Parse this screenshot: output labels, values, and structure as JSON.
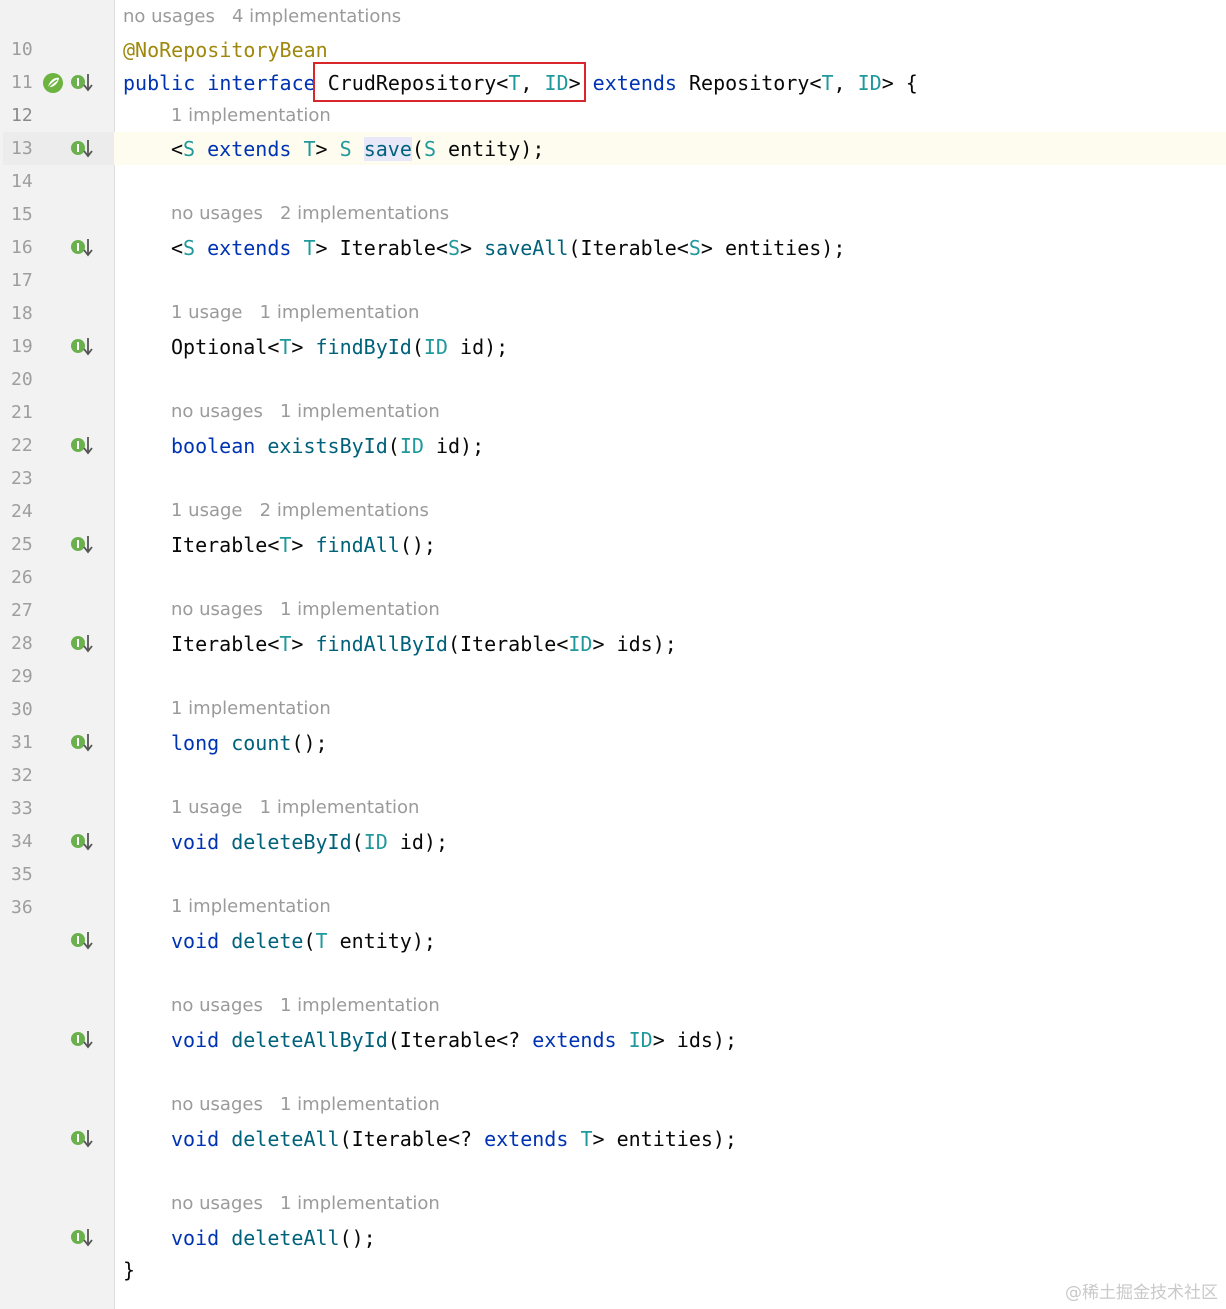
{
  "editor": {
    "class_hint": "no usages   4 implementations",
    "annotation": "@NoRepositoryBean",
    "decl": {
      "public_kw": "public",
      "interface_kw": "interface",
      "name": "CrudRepository",
      "lt": "<",
      "t": "T",
      "comma": ", ",
      "id": "ID",
      "gt": ">",
      "extends_kw": "extends",
      "parent": "Repository",
      "parent_lt": "<",
      "parent_t": "T",
      "parent_comma": ", ",
      "parent_id": "ID",
      "parent_gt": ">",
      "brace": " {"
    },
    "closing_brace": "}",
    "line_numbers": [
      "10",
      "11",
      "12",
      "13",
      "14",
      "15",
      "16",
      "17",
      "18",
      "19",
      "20",
      "21",
      "22",
      "23",
      "24",
      "25",
      "26",
      "27",
      "28",
      "29",
      "30",
      "31",
      "32",
      "33",
      "34",
      "35",
      "36"
    ],
    "hints": [
      "1 implementation",
      "no usages   2 implementations",
      "1 usage   1 implementation",
      "no usages   1 implementation",
      "1 usage   2 implementations",
      "no usages   1 implementation",
      "1 implementation",
      "1 usage   1 implementation",
      "1 implementation",
      "no usages   1 implementation",
      "no usages   1 implementation",
      "no usages   1 implementation"
    ],
    "methods": [
      [
        [
          "p",
          "<"
        ],
        [
          "t",
          "S"
        ],
        [
          "p",
          " "
        ],
        [
          "k",
          "extends"
        ],
        [
          "p",
          " "
        ],
        [
          "t",
          "T"
        ],
        [
          "p",
          "> "
        ],
        [
          "t",
          "S"
        ],
        [
          "p",
          " "
        ],
        [
          "caret",
          ""
        ],
        [
          "fh",
          "save"
        ],
        [
          "p",
          "("
        ],
        [
          "t",
          "S"
        ],
        [
          "p",
          " entity);"
        ]
      ],
      [
        [
          "p",
          "<"
        ],
        [
          "t",
          "S"
        ],
        [
          "p",
          " "
        ],
        [
          "k",
          "extends"
        ],
        [
          "p",
          " "
        ],
        [
          "t",
          "T"
        ],
        [
          "p",
          "> Iterable<"
        ],
        [
          "t",
          "S"
        ],
        [
          "p",
          "> "
        ],
        [
          "f",
          "saveAll"
        ],
        [
          "p",
          "(Iterable<"
        ],
        [
          "t",
          "S"
        ],
        [
          "p",
          "> entities);"
        ]
      ],
      [
        [
          "p",
          "Optional<"
        ],
        [
          "t",
          "T"
        ],
        [
          "p",
          "> "
        ],
        [
          "f",
          "findById"
        ],
        [
          "p",
          "("
        ],
        [
          "t",
          "ID"
        ],
        [
          "p",
          " id);"
        ]
      ],
      [
        [
          "k",
          "boolean"
        ],
        [
          "p",
          " "
        ],
        [
          "f",
          "existsById"
        ],
        [
          "p",
          "("
        ],
        [
          "t",
          "ID"
        ],
        [
          "p",
          " id);"
        ]
      ],
      [
        [
          "p",
          "Iterable<"
        ],
        [
          "t",
          "T"
        ],
        [
          "p",
          "> "
        ],
        [
          "f",
          "findAll"
        ],
        [
          "p",
          "();"
        ]
      ],
      [
        [
          "p",
          "Iterable<"
        ],
        [
          "t",
          "T"
        ],
        [
          "p",
          "> "
        ],
        [
          "f",
          "findAllById"
        ],
        [
          "p",
          "(Iterable<"
        ],
        [
          "t",
          "ID"
        ],
        [
          "p",
          "> ids);"
        ]
      ],
      [
        [
          "k",
          "long"
        ],
        [
          "p",
          " "
        ],
        [
          "f",
          "count"
        ],
        [
          "p",
          "();"
        ]
      ],
      [
        [
          "k",
          "void"
        ],
        [
          "p",
          " "
        ],
        [
          "f",
          "deleteById"
        ],
        [
          "p",
          "("
        ],
        [
          "t",
          "ID"
        ],
        [
          "p",
          " id);"
        ]
      ],
      [
        [
          "k",
          "void"
        ],
        [
          "p",
          " "
        ],
        [
          "f",
          "delete"
        ],
        [
          "p",
          "("
        ],
        [
          "t",
          "T"
        ],
        [
          "p",
          " entity);"
        ]
      ],
      [
        [
          "k",
          "void"
        ],
        [
          "p",
          " "
        ],
        [
          "f",
          "deleteAllById"
        ],
        [
          "p",
          "(Iterable<? "
        ],
        [
          "k",
          "extends"
        ],
        [
          "p",
          " "
        ],
        [
          "t",
          "ID"
        ],
        [
          "p",
          "> ids);"
        ]
      ],
      [
        [
          "k",
          "void"
        ],
        [
          "p",
          " "
        ],
        [
          "f",
          "deleteAll"
        ],
        [
          "p",
          "(Iterable<? "
        ],
        [
          "k",
          "extends"
        ],
        [
          "p",
          " "
        ],
        [
          "t",
          "T"
        ],
        [
          "p",
          "> entities);"
        ]
      ],
      [
        [
          "k",
          "void"
        ],
        [
          "p",
          " "
        ],
        [
          "f",
          "deleteAll"
        ],
        [
          "p",
          "();"
        ]
      ]
    ]
  },
  "icons": {
    "gutter": "implemented-method-icon",
    "spring": "spring-bean-icon"
  },
  "colors": {
    "keyword": "#0033b3",
    "type_param": "#20999d",
    "method": "#00627a",
    "annotation": "#9e880d",
    "highlight_box": "#d9262b"
  },
  "watermark": "@稀土掘金技术社区"
}
